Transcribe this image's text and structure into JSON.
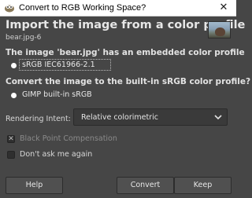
{
  "window": {
    "title": "Convert to RGB Working Space?",
    "close_glyph": "✕",
    "icon": "gimp-app-icon"
  },
  "dialog": {
    "heading": "Import the image from a color profile",
    "subheading": "bear.jpg-6",
    "thumbnail": "bear-image-thumbnail",
    "embedded_label": "The image 'bear.jpg' has an embedded color profile",
    "embedded_profile": "sRGB IEC61966-2.1",
    "convert_label": "Convert the image to the built-in sRGB color profile?",
    "builtin_profile": "GIMP built-in sRGB",
    "rendering_intent_label": "Rendering Intent:",
    "rendering_intent_value": "Relative colorimetric",
    "black_point_label": "Black Point Compensation",
    "black_point_checked": true,
    "black_point_enabled": false,
    "dont_ask_label": "Don't ask me again",
    "dont_ask_checked": false
  },
  "buttons": {
    "help": "Help",
    "convert": "Convert",
    "keep": "Keep"
  },
  "colors": {
    "background": "#464646",
    "titlebar": "#ffffff",
    "button": "#505050",
    "combo": "#3a3a3a"
  }
}
